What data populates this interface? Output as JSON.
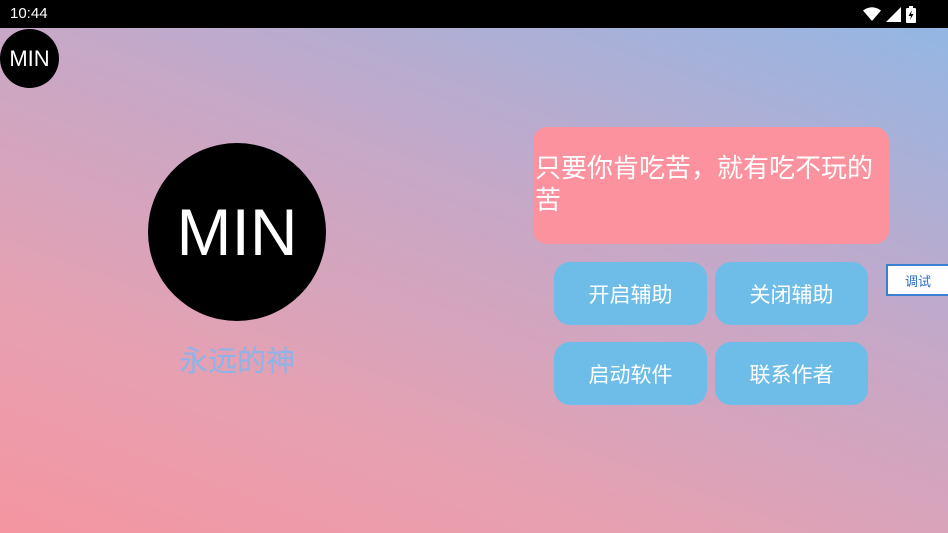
{
  "status_bar": {
    "time": "10:44",
    "icons": [
      "wifi-icon",
      "signal-icon",
      "battery-charging-icon"
    ]
  },
  "small_avatar": {
    "label": "MIN"
  },
  "profile": {
    "avatar_label": "MIN",
    "subtitle": "永远的神"
  },
  "quote": {
    "text": "只要你肯吃苦，就有吃不玩的苦"
  },
  "buttons": {
    "enable_assist": "开启辅助",
    "disable_assist": "关闭辅助",
    "launch_software": "启动软件",
    "contact_author": "联系作者"
  },
  "debug": {
    "label": "调试"
  },
  "colors": {
    "status_bar": "#000000",
    "quote_bg": "#fb929e",
    "button_bg": "#6dbde8",
    "subtitle": "#8ab4ea",
    "debug_border": "#3a7fd0"
  }
}
